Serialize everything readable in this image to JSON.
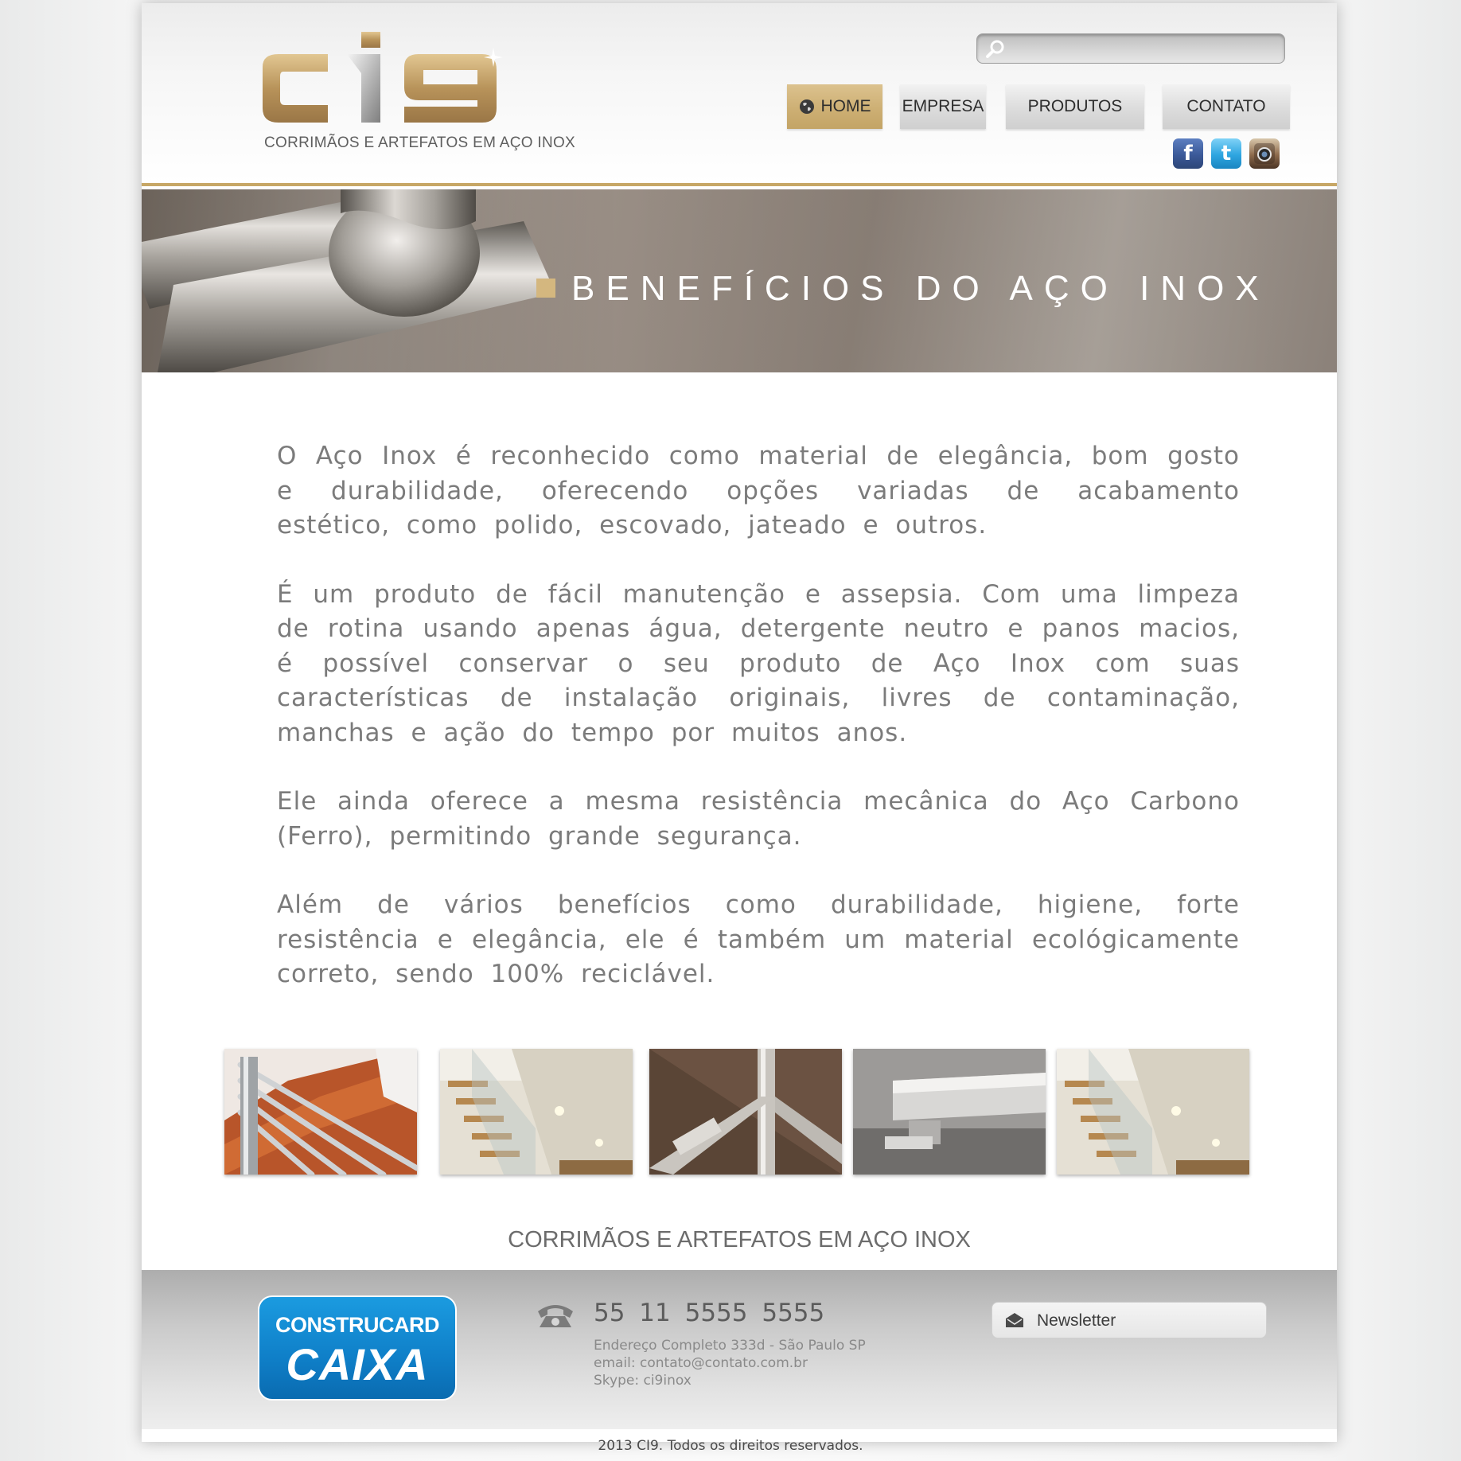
{
  "header": {
    "logo_text": "ci9",
    "tagline": "CORRIMÃOS E ARTEFATOS EM AÇO INOX",
    "search": {
      "value": "",
      "placeholder": ""
    },
    "nav": [
      {
        "label": "HOME",
        "active": true
      },
      {
        "label": "EMPRESA",
        "active": false
      },
      {
        "label": "PRODUTOS",
        "active": false
      },
      {
        "label": "CONTATO",
        "active": false
      }
    ],
    "social": [
      "facebook-icon",
      "twitter-icon",
      "instagram-icon"
    ]
  },
  "banner": {
    "title": "BENEFÍCIOS DO AÇO INOX"
  },
  "content": {
    "paragraphs": [
      "O Aço Inox é reconhecido como material de elegância, bom gosto e durabilidade, oferecendo opções variadas de acabamento estético, como polido, escovado, jateado e outros.",
      "É um produto de fácil manutenção e assepsia. Com uma limpeza de rotina usando apenas água, detergente neutro e panos macios, é possível conservar o seu produto de Aço Inox com suas características de instalação originais, livres de contaminação, manchas e ação do tempo por muitos anos.",
      "Ele ainda oferece a mesma resistência mecânica do Aço Carbono (Ferro), permitindo grande segurança.",
      "Além de vários benefícios como durabilidade, higiene, forte resistência e elegância, ele é também um material ecológicamente correto, sendo 100% reciclável."
    ]
  },
  "gallery": {
    "thumbnails": [
      "stair-railing",
      "glass-staircase",
      "inox-corner-detail",
      "handrail-bracket",
      "glass-staircase"
    ]
  },
  "footer": {
    "tagline": "CORRIMÃOS E ARTEFATOS EM AÇO INOX",
    "construcard_line1": "CONSTRUCARD",
    "construcard_line2": "CAIXA",
    "phone": "55 11 5555 5555",
    "address": "Endereço Completo 333d - São Paulo SP",
    "email": "email: contato@contato.com.br",
    "skype": "Skype: ci9inox",
    "newsletter_label": "Newsletter"
  },
  "copyright": "2013 CI9. Todos os direitos reservados.",
  "colors": {
    "gold": "#c7a766",
    "nav_active": "#ccae72",
    "text_gray": "#7b7b7b",
    "caixa_blue": "#0f7fc8"
  }
}
